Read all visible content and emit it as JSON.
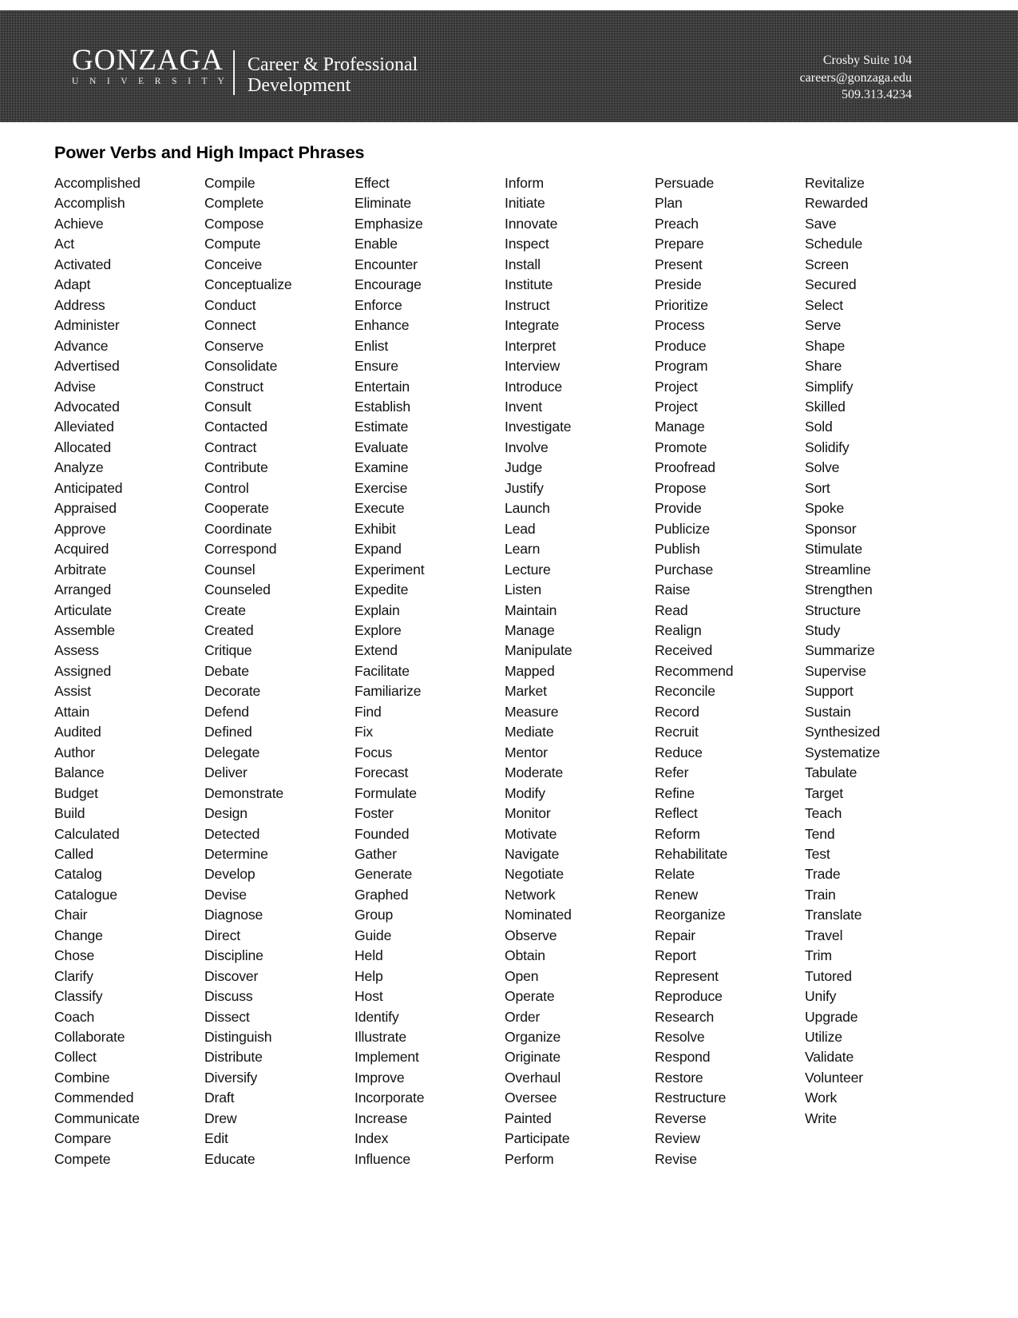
{
  "banner": {
    "logo_word": "GONZAGA",
    "logo_sub": "U N I V E R S I T Y",
    "department_line1": "Career & Professional",
    "department_line2": "Development",
    "contact": [
      "Crosby Suite 104",
      "careers@gonzaga.edu",
      "509.313.4234"
    ],
    "background_color": "#1a1a1a",
    "text_color": "#ffffff"
  },
  "document": {
    "title": "Power Verbs and High Impact Phrases",
    "columns": [
      {
        "name": "column-1",
        "items": [
          "Accomplished",
          "Accomplish",
          "Achieve",
          "Act",
          "Activated",
          "Adapt",
          "Address",
          "Administer",
          "Advance",
          "Advertised",
          "Advise",
          "Advocated",
          "Alleviated",
          "Allocated",
          "Analyze",
          "Anticipated",
          "Appraised",
          "Approve",
          "Acquired",
          "Arbitrate",
          "Arranged",
          "Articulate",
          "Assemble",
          "Assess",
          "Assigned",
          "Assist",
          "Attain",
          "Audited",
          "Author",
          "Balance",
          "Budget",
          "Build",
          "Calculated",
          "Called",
          "Catalog",
          "Catalogue",
          "Chair",
          "Change",
          "Chose",
          "Clarify",
          "Classify",
          "Coach",
          "Collaborate",
          "Collect",
          "Combine",
          "Commended",
          "Communicate",
          "Compare",
          "Compete"
        ]
      },
      {
        "name": "column-2",
        "items": [
          "Compile",
          "Complete",
          "Compose",
          "Compute",
          "Conceive",
          "Conceptualize",
          "Conduct",
          "Connect",
          "Conserve",
          "Consolidate",
          "Construct",
          "Consult",
          "Contacted",
          "Contract",
          "Contribute",
          "Control",
          "Cooperate",
          "Coordinate",
          "Correspond",
          "Counsel",
          "Counseled",
          "Create",
          "Created",
          "Critique",
          "Debate",
          "Decorate",
          "Defend",
          "Defined",
          "Delegate",
          "Deliver",
          "Demonstrate",
          "Design",
          "Detected",
          "Determine",
          "Develop",
          "Devise",
          "Diagnose",
          "Direct",
          "Discipline",
          "Discover",
          "Discuss",
          "Dissect",
          "Distinguish",
          "Distribute",
          "Diversify",
          "Draft",
          "Drew",
          "Edit",
          "Educate"
        ]
      },
      {
        "name": "column-3",
        "items": [
          "Effect",
          "Eliminate",
          "Emphasize",
          "Enable",
          "Encounter",
          "Encourage",
          "Enforce",
          "Enhance",
          "Enlist",
          "Ensure",
          "Entertain",
          "Establish",
          "Estimate",
          "Evaluate",
          "Examine",
          "Exercise",
          "Execute",
          "Exhibit",
          "Expand",
          "Experiment",
          "Expedite",
          "Explain",
          "Explore",
          "Extend",
          "Facilitate",
          "Familiarize",
          "Find",
          "Fix",
          "Focus",
          "Forecast",
          "Formulate",
          "Foster",
          "Founded",
          "Gather",
          "Generate",
          "Graphed",
          "Group",
          "Guide",
          "Held",
          "Help",
          "Host",
          "Identify",
          "Illustrate",
          "Implement",
          "Improve",
          "Incorporate",
          "Increase",
          "Index",
          "Influence"
        ]
      },
      {
        "name": "column-4",
        "items": [
          "Inform",
          "Initiate",
          "Innovate",
          "Inspect",
          "Install",
          "Institute",
          "Instruct",
          "Integrate",
          "Interpret",
          "Interview",
          "Introduce",
          "Invent",
          "Investigate",
          "Involve",
          "Judge",
          "Justify",
          "Launch",
          "Lead",
          "Learn",
          "Lecture",
          "Listen",
          "Maintain",
          "Manage",
          "Manipulate",
          "Mapped",
          "Market",
          "Measure",
          "Mediate",
          "Mentor",
          "Moderate",
          "Modify",
          "Monitor",
          "Motivate",
          "Navigate",
          "Negotiate",
          "Network",
          "Nominated",
          "Observe",
          "Obtain",
          "Open",
          "Operate",
          "Order",
          "Organize",
          "Originate",
          "Overhaul",
          "Oversee",
          "Painted",
          "Participate",
          "Perform"
        ]
      },
      {
        "name": "column-5",
        "items": [
          "Persuade",
          "Plan",
          "Preach",
          "Prepare",
          "Present",
          "Preside",
          "Prioritize",
          "Process",
          "Produce",
          "Program",
          "Project",
          "Project",
          "Manage",
          "Promote",
          "Proofread",
          "Propose",
          "Provide",
          "Publicize",
          "Publish",
          "Purchase",
          "Raise",
          "Read",
          "Realign",
          "Received",
          "Recommend",
          "Reconcile",
          "Record",
          "Recruit",
          "Reduce",
          "Refer",
          "Refine",
          "Reflect",
          "Reform",
          "Rehabilitate",
          "Relate",
          "Renew",
          "Reorganize",
          "Repair",
          "Report",
          "Represent",
          "Reproduce",
          "Research",
          "Resolve",
          "Respond",
          "Restore",
          "Restructure",
          "Reverse",
          "Review",
          "Revise"
        ]
      },
      {
        "name": "column-6",
        "items": [
          "Revitalize",
          "Rewarded",
          "Save",
          "Schedule",
          "Screen",
          "Secured",
          "Select",
          "Serve",
          "Shape",
          "Share",
          "Simplify",
          "Skilled",
          "Sold",
          "Solidify",
          "Solve",
          "Sort",
          "Spoke",
          "Sponsor",
          "Stimulate",
          "Streamline",
          "Strengthen",
          "Structure",
          "Study",
          "Summarize",
          "Supervise",
          "Support",
          "Sustain",
          "Synthesized",
          "Systematize",
          "Tabulate",
          "Target",
          "Teach",
          "Tend",
          "Test",
          "Trade",
          "Train",
          "Translate",
          "Travel",
          "Trim",
          "Tutored",
          "Unify",
          "Upgrade",
          "Utilize",
          "Validate",
          "Volunteer",
          "Work",
          "Write"
        ]
      }
    ]
  }
}
